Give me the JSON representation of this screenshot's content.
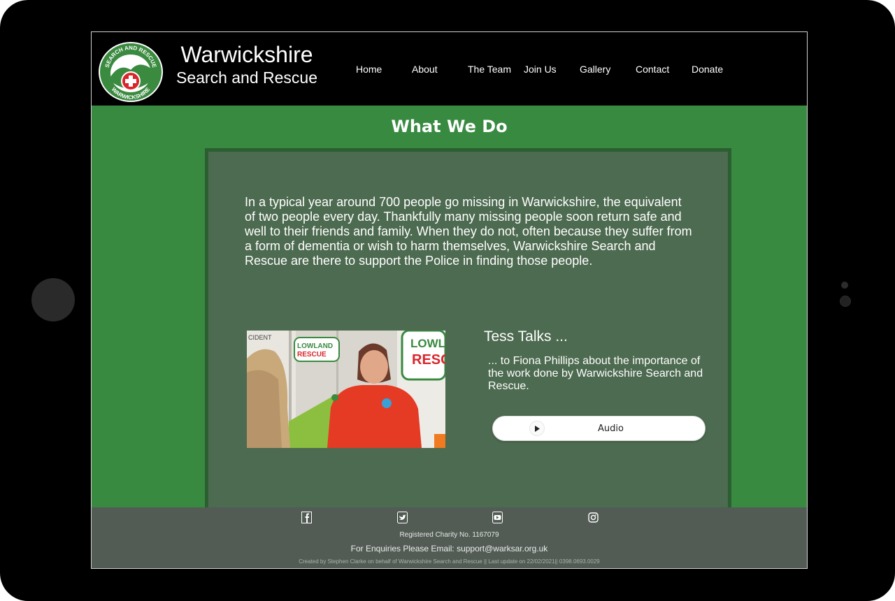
{
  "site": {
    "title": "Warwickshire",
    "subtitle": "Search and Rescue",
    "logo_text_top": "SEARCH AND RESCUE",
    "logo_text_bottom": "WARWICKSHIRE"
  },
  "nav": {
    "items": [
      {
        "label": "Home"
      },
      {
        "label": "About"
      },
      {
        "label": "The Team"
      },
      {
        "label": "Join Us"
      },
      {
        "label": "Gallery"
      },
      {
        "label": "Contact"
      },
      {
        "label": "Donate"
      }
    ]
  },
  "main": {
    "heading": "What We Do",
    "intro": "In a typical year around 700 people go missing in Warwickshire, the equivalent of two people every day. Thankfully many missing people soon return safe and well to their friends and family. When they do not, often because they suffer from a form of dementia or wish to harm themselves, Warwickshire Search and Rescue are there to support the Police in finding those people.",
    "video": {
      "van_text_left_top": "LOWLAND",
      "van_text_left_bottom": "RESCUE",
      "van_text_right_top": "LOWLA",
      "van_text_right_bottom": "RESC",
      "van_text_edge": "CIDENT"
    },
    "tess_title": "Tess Talks ...",
    "tess_description": "... to Fiona Phillips about the importance of the work done by Warwickshire Search and Rescue.",
    "audio_label": "Audio"
  },
  "footer": {
    "social_icons": [
      "facebook-icon",
      "twitter-icon",
      "youtube-icon",
      "instagram-icon"
    ],
    "charity": "Registered Charity No. 1167079",
    "enquiries": "For Enquiries Please Email: support@warksar.org.uk",
    "credits": "Created by Stephen Clarke on behalf of Warwickshire Search and Rescue || Last update on 22/02/2021|| 0398.0693.0029"
  },
  "colors": {
    "page_green": "#388a41",
    "panel": "#4d6b50",
    "panel_border": "#2b5e30",
    "header": "#000000",
    "footer": "#525c55"
  }
}
